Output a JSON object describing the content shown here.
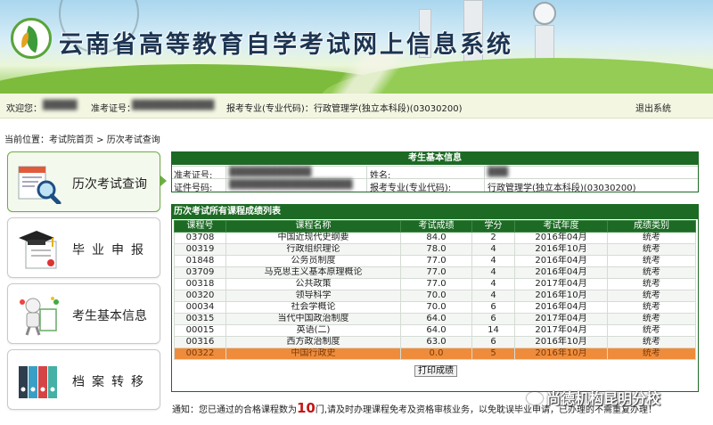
{
  "header": {
    "site_title": "云南省高等教育自学考试网上信息系统"
  },
  "infobar": {
    "welcome_label": "欢迎您：",
    "welcome_value": "█████",
    "exam_no_label": "准考证号：",
    "exam_no_value": "████████████",
    "major_label": "报考专业(专业代码)：",
    "major_value": "行政管理学(独立本科段)(03030200)",
    "logout_label": "退出系统"
  },
  "breadcrumb": "当前位置：考试院首页 > 历次考试查询",
  "sidebar": {
    "items": [
      {
        "label": "历次考试查询"
      },
      {
        "label": "毕业申报"
      },
      {
        "label": "考生基本信息"
      },
      {
        "label": "档案转移"
      }
    ]
  },
  "basic_info": {
    "title": "考生基本信息",
    "exam_no_label": "准考证号:",
    "exam_no_value": "████████████",
    "name_label": "姓名:",
    "name_value": "███",
    "id_label": "证件号码:",
    "id_value": "██████████████████",
    "major_label": "报考专业(专业代码):",
    "major_value": "行政管理学(独立本科段)(03030200)"
  },
  "scores": {
    "title": "历次考试所有课程成绩列表",
    "columns": [
      "课程号",
      "课程名称",
      "考试成绩",
      "学分",
      "考试年度",
      "成绩类别"
    ],
    "rows": [
      [
        "03708",
        "中国近现代史纲要",
        "84.0",
        "2",
        "2016年04月",
        "统考"
      ],
      [
        "00319",
        "行政组织理论",
        "78.0",
        "4",
        "2016年10月",
        "统考"
      ],
      [
        "01848",
        "公务员制度",
        "77.0",
        "4",
        "2016年04月",
        "统考"
      ],
      [
        "03709",
        "马克思主义基本原理概论",
        "77.0",
        "4",
        "2016年04月",
        "统考"
      ],
      [
        "00318",
        "公共政策",
        "77.0",
        "4",
        "2017年04月",
        "统考"
      ],
      [
        "00320",
        "领导科学",
        "70.0",
        "4",
        "2016年10月",
        "统考"
      ],
      [
        "00034",
        "社会学概论",
        "70.0",
        "6",
        "2016年04月",
        "统考"
      ],
      [
        "00315",
        "当代中国政治制度",
        "64.0",
        "6",
        "2017年04月",
        "统考"
      ],
      [
        "00015",
        "英语(二)",
        "64.0",
        "14",
        "2017年04月",
        "统考"
      ],
      [
        "00316",
        "西方政治制度",
        "63.0",
        "6",
        "2016年10月",
        "统考"
      ],
      [
        "00322",
        "中国行政史",
        "0.0",
        "5",
        "2016年10月",
        "统考"
      ]
    ],
    "print_label": "打印成绩"
  },
  "notice": {
    "prefix": "通知：您已通过的合格课程数为",
    "count": "10",
    "suffix": "门,请及时办理课程免考及资格审核业务，以免耽误毕业申请，已办理的不需重复办理！"
  },
  "watermark": "尚德机构昆明分校",
  "colors": {
    "panel_green": "#1d6a25",
    "highlight_orange": "#ef8c3b",
    "notice_red": "#c31616"
  }
}
